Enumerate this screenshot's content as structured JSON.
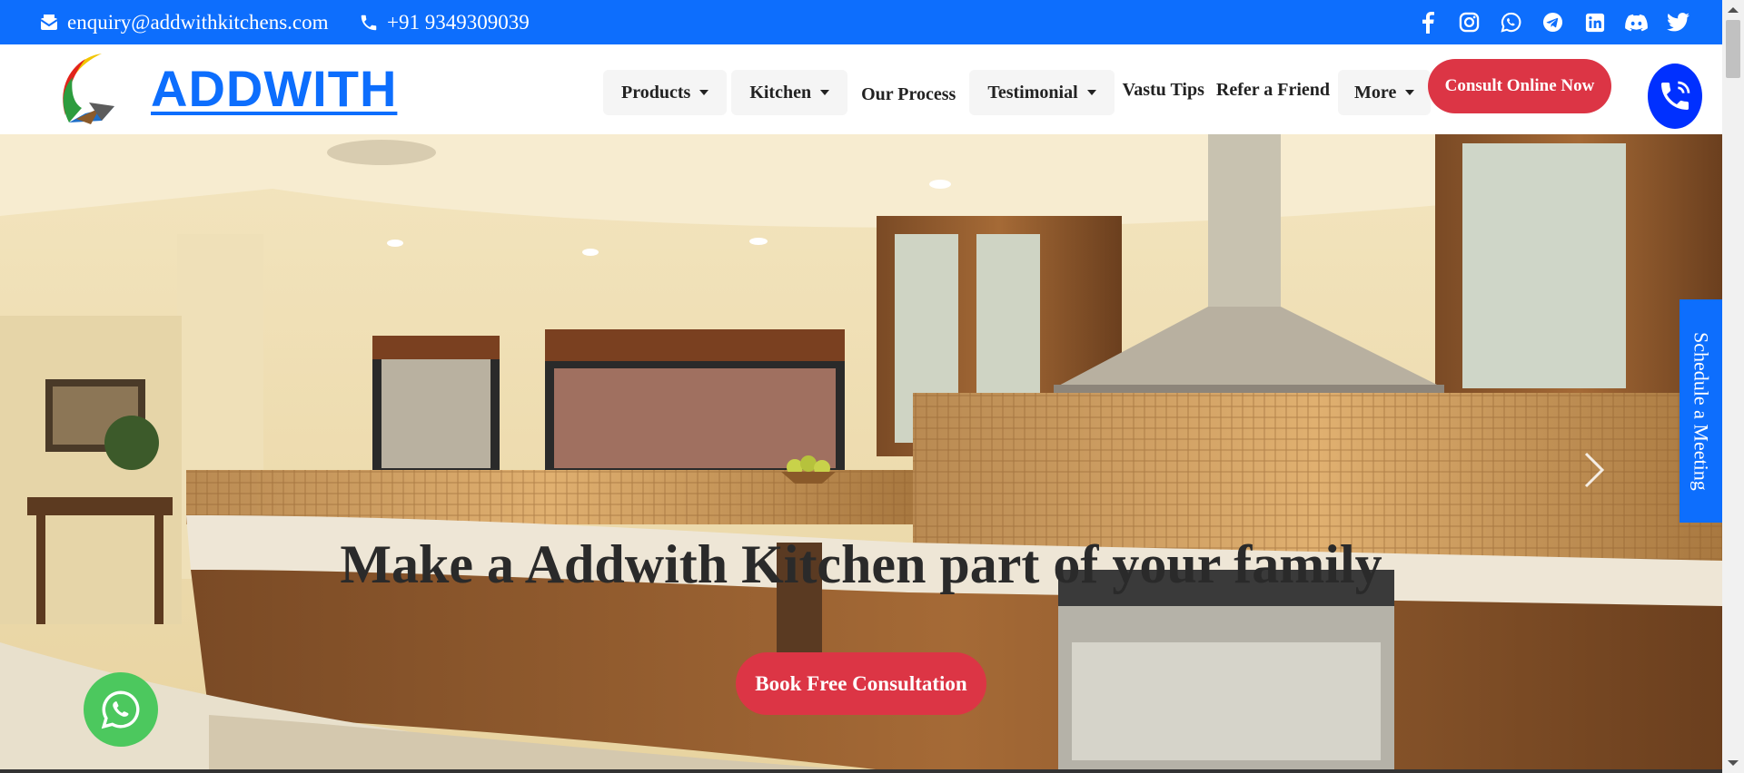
{
  "topbar": {
    "email": "enquiry@addwithkitchens.com",
    "phone": "+91 9349309039",
    "icons": [
      "mail-icon",
      "phone-icon"
    ],
    "social": [
      "facebook-icon",
      "instagram-icon",
      "whatsapp-icon",
      "telegram-icon",
      "linkedin-icon",
      "discord-icon",
      "twitter-icon"
    ]
  },
  "brand": {
    "name": "ADDWITH"
  },
  "nav": {
    "items": [
      {
        "label": "Products",
        "dropdown": true
      },
      {
        "label": "Kitchen",
        "dropdown": true
      },
      {
        "label": "Our Process",
        "dropdown": false
      },
      {
        "label": "Testimonial",
        "dropdown": true
      },
      {
        "label": "Vastu Tips",
        "dropdown": false
      },
      {
        "label": "Refer a Friend",
        "dropdown": false
      },
      {
        "label": "More",
        "dropdown": true
      }
    ],
    "cta": "Consult Online Now"
  },
  "hero": {
    "title": "Make a Addwith Kitchen part of your family",
    "button": "Book Free Consultation"
  },
  "side_tab": {
    "label": "Schedule a Meeting"
  },
  "colors": {
    "primary": "#0d6efd",
    "cta": "#dc3545",
    "whatsapp": "#4cc85e",
    "call": "#0030ff"
  }
}
